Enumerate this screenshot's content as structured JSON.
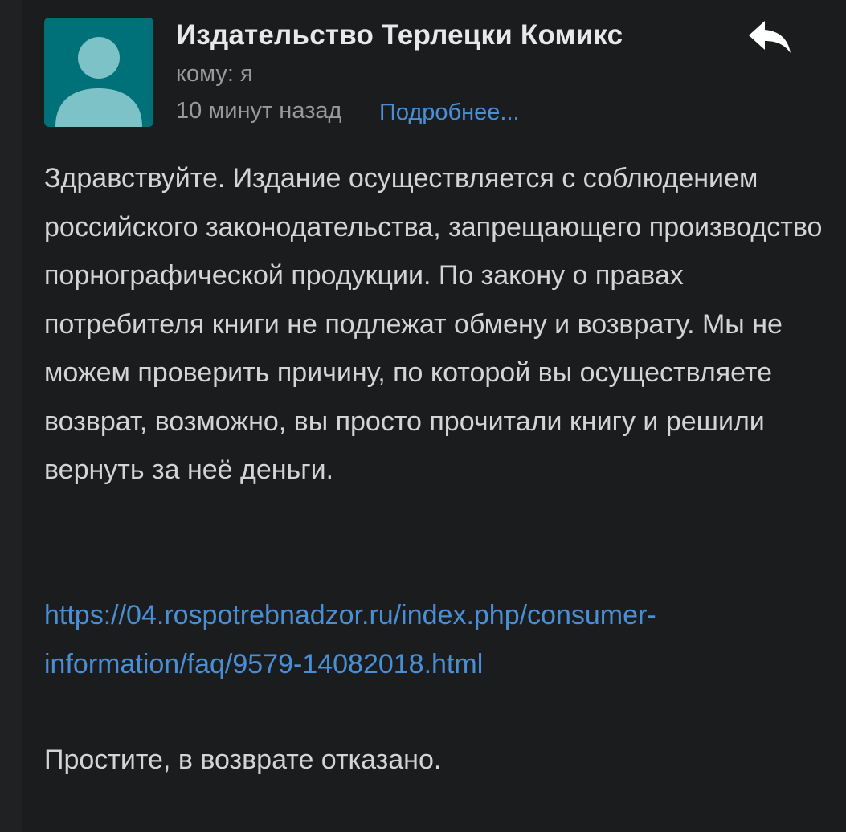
{
  "email": {
    "sender_name": "Издательство Терлецки Комикс",
    "recipient": "кому: я",
    "time": "10 минут назад",
    "details_link": "Подробнее...",
    "body_paragraph": "Здравствуйте. Издание осуществляется с соблюдением российского законодательства, запрещающего производство порнографической продукции. По закону о правах потребителя книги не подлежат обмену и возврату. Мы не можем проверить причину, по которой вы осуществляете возврат, возможно, вы просто прочитали книгу и решили вернуть за неё деньги.",
    "link_url": "https://04.rospotrebnadzor.ru/index.php/consumer-information/faq/9579-14082018.html",
    "closing": "Простите, в возврате отказано."
  },
  "icons": {
    "avatar": "default-avatar-icon",
    "reply": "reply-arrow-icon"
  },
  "colors": {
    "background": "#1b1c1e",
    "avatar_bg": "#007179",
    "link": "#4a8fd6",
    "muted": "#9a9a9a",
    "text": "#d4d4d4"
  }
}
